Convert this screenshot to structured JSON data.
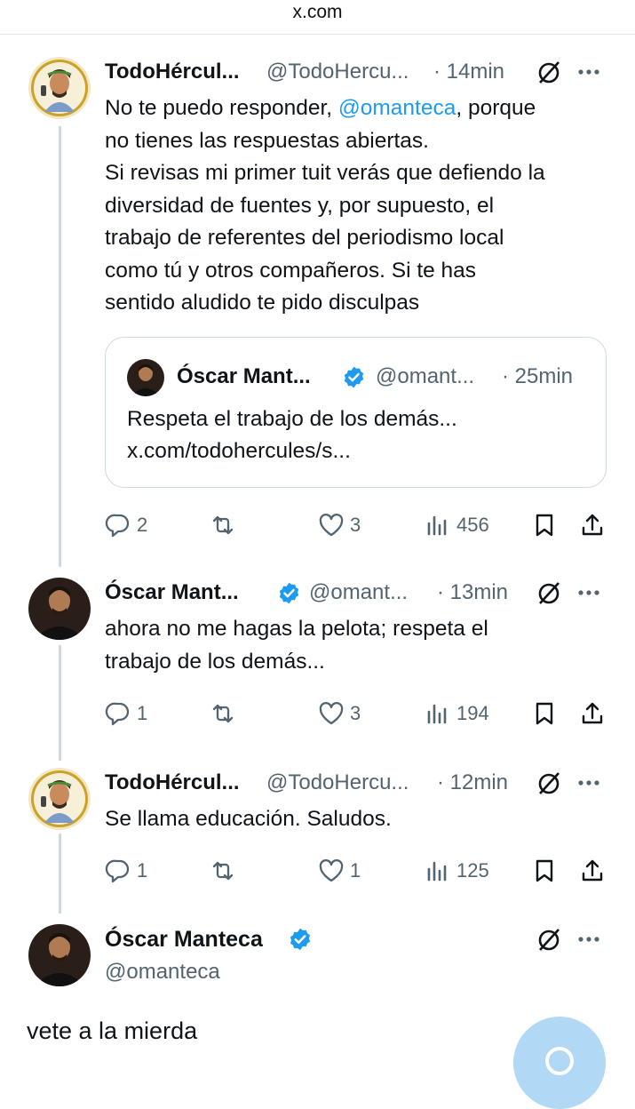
{
  "browser": {
    "url": "x.com"
  },
  "tweets": [
    {
      "author_name": "TodoHércul...",
      "handle": "@TodoHercu...",
      "time": "· 14min",
      "text_lines": [
        [
          "No te puedo responder, ",
          "@omanteca",
          ", porque"
        ],
        "no tienes las respuestas abiertas.",
        "Si revisas mi primer tuit verás que defiendo la",
        "diversidad de fuentes y, por supuesto, el",
        "trabajo de referentes del periodismo local",
        "como tú y otros compañeros. Si te has",
        "sentido aludido te pido disculpas"
      ],
      "quote": {
        "author_name": "Óscar Mant...",
        "handle": "@omant...",
        "time": "· 25min",
        "text_line1": "Respeta el trabajo de los demás...",
        "text_line2": "x.com/todohercules/s..."
      },
      "replies": "2",
      "reposts": "",
      "likes": "3",
      "views": "456"
    },
    {
      "author_name": "Óscar Mant...",
      "handle": "@omant...",
      "time": "· 13min",
      "text_line1": "ahora no me hagas la pelota; respeta el",
      "text_line2": "trabajo de los demás...",
      "replies": "1",
      "reposts": "",
      "likes": "3",
      "views": "194"
    },
    {
      "author_name": "TodoHércul...",
      "handle": "@TodoHercu...",
      "time": "· 12min",
      "text_line1": "Se llama educación. Saludos.",
      "replies": "1",
      "reposts": "",
      "likes": "1",
      "views": "125"
    }
  ],
  "main_tweet": {
    "author_name": "Óscar Manteca",
    "handle": "@omanteca",
    "text": "vete a la mierda"
  },
  "icons": {
    "verified": "verified-badge-icon",
    "grok": "grok-icon",
    "more": "more-icon",
    "reply": "reply-icon",
    "repost": "repost-icon",
    "like": "like-icon",
    "views": "views-icon",
    "bookmark": "bookmark-icon",
    "share": "share-icon"
  },
  "colors": {
    "text": "#0f1419",
    "secondary": "#536471",
    "accent": "#1d9bf0",
    "thread_line": "#cfd9de"
  }
}
